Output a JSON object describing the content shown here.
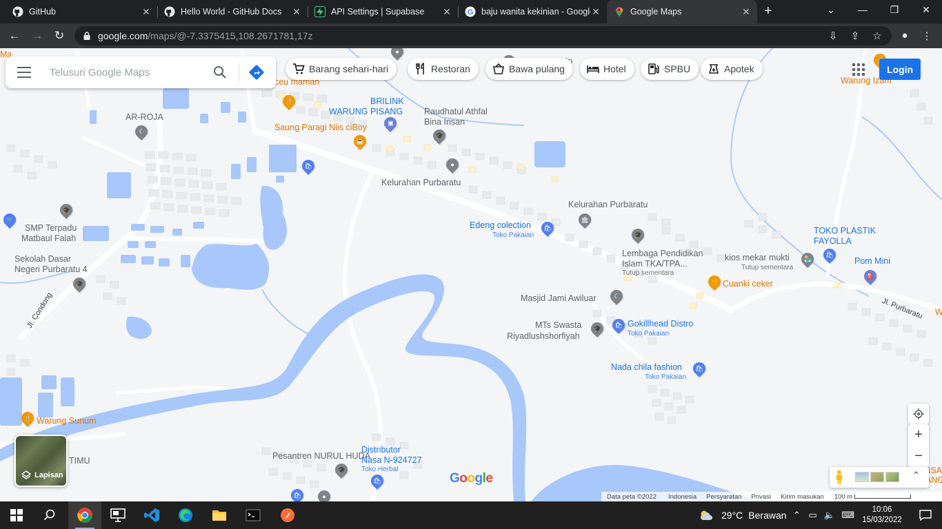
{
  "browser": {
    "tabs": [
      {
        "title": "GitHub",
        "icon": "github-icon"
      },
      {
        "title": "Hello World - GitHub Docs",
        "icon": "github-icon"
      },
      {
        "title": "API Settings | Supabase",
        "icon": "supabase-icon"
      },
      {
        "title": "baju wanita kekinian - Google",
        "icon": "google-icon"
      },
      {
        "title": "Google Maps",
        "icon": "maps-icon",
        "active": true
      }
    ],
    "url_domain": "google.com",
    "url_path": "/maps/@-7.3375415,108.2671781,17z"
  },
  "search": {
    "placeholder": "Telusuri Google Maps"
  },
  "categories": [
    {
      "label": "Barang sehari-hari",
      "icon": "cart-icon"
    },
    {
      "label": "Restoran",
      "icon": "restaurant-icon"
    },
    {
      "label": "Bawa pulang",
      "icon": "takeout-icon"
    },
    {
      "label": "Hotel",
      "icon": "hotel-icon"
    },
    {
      "label": "SPBU",
      "icon": "gas-station-icon"
    },
    {
      "label": "Apotek",
      "icon": "pharmacy-icon"
    }
  ],
  "login_label": "Login",
  "layers_label": "Lapisan",
  "places": {
    "ar_roja": "AR-ROJA",
    "brilink": "BRILINK",
    "warung_pisang": "WARUNG PISANG",
    "raudhatul1": "Raudhatul Athfal",
    "raudhatul2": "Bina Insan",
    "saung": "Saung Paragi Niis ciBoy",
    "kel1": "Kelurahan Purbaratu",
    "kel2": "Kelurahan Purbaratu",
    "smp1": "SMP Terpadu",
    "smp2": "Matbaul Falah",
    "sd1": "Sekolah Dasar",
    "sd2": "Negeri Purbaratu 4",
    "edeng": "Edeng colection",
    "edeng_sub": "Toko Pakaian",
    "lembaga1": "Lembaga Pendidikan",
    "lembaga2": "Islam TKA/TPA...",
    "lembaga_sub": "Tutup sementara",
    "kios": "kios mekar mukti",
    "kios_sub": "Tutup sementara",
    "toko_plastik1": "TOKO PLASTIK",
    "toko_plastik2": "FAYOLLA",
    "pom": "Pom Mini",
    "cuanki": "Cuanki ceker",
    "masjid": "Masjid Jami Awiluar",
    "mts1": "MTs Swasta",
    "mts2": "Riyadlushshorfiyah",
    "gokill": "Gokillhead Distro",
    "gokill_sub": "Toko Pakaian",
    "nada": "Nada chila fashion",
    "nada_sub": "Toko Pakaian",
    "warung_sunum": "Warung Sunum",
    "timu": "TIMU",
    "pesantren": "Pesantren NURUL HUDA",
    "dist1": "Distributor",
    "dist2": "Nasa N-924727",
    "dist_sub": "Toko Herbal",
    "warung_izam": "Warung Izam",
    "ceu_maman": "ceu maman",
    "jl_condong": "Jl. Condong",
    "jl_purbaratu": "Jl. Purbaratu",
    "ma": "Ma",
    "kp": "Kp",
    "w": "W",
    "isat1": "ISAT",
    "isat2": "ANG"
  },
  "map_brand": "Google",
  "footer": {
    "data": "Data peta ©2022",
    "region": "Indonesia",
    "terms": "Persyaratan",
    "privacy": "Privasi",
    "feedback": "Kirim masukan",
    "scale": "100 m"
  },
  "taskbar": {
    "temp": "29°C",
    "weather": "Berawan",
    "time": "10:06",
    "date": "15/03/2022"
  }
}
